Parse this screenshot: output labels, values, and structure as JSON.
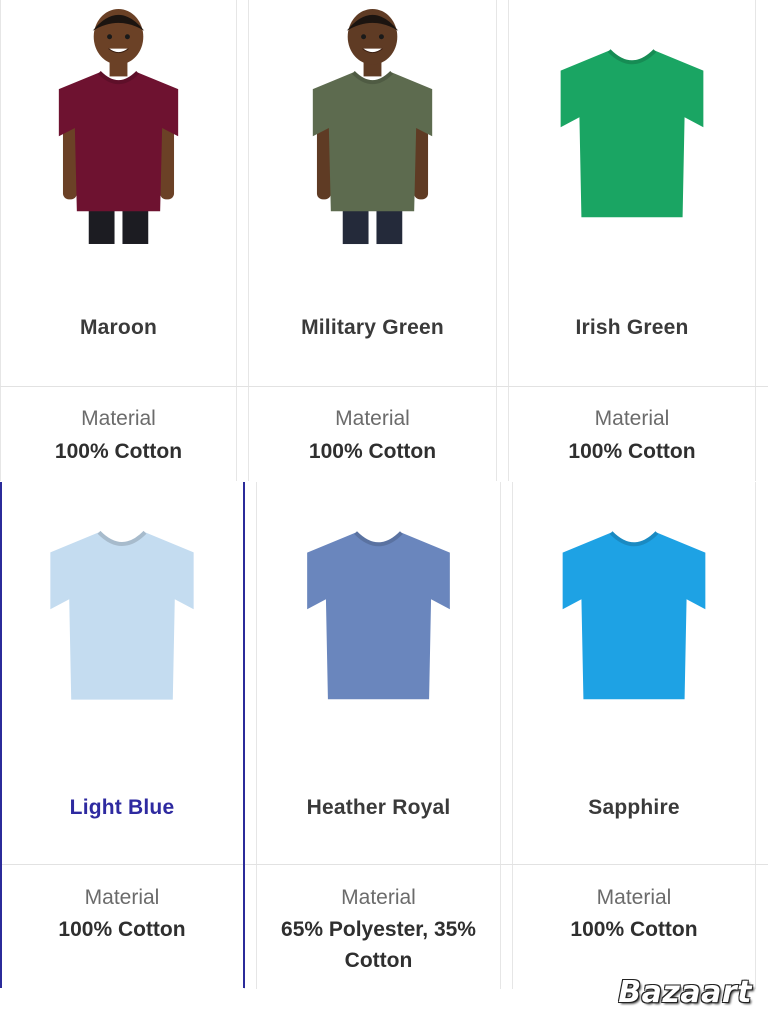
{
  "products": [
    {
      "color_name": "Maroon",
      "material_label": "Material",
      "material_value": "100% Cotton",
      "swatch": "#6e1230",
      "has_model": true,
      "skin": "#6b4126",
      "pants": "#1c1c22"
    },
    {
      "color_name": "Military Green",
      "material_label": "Material",
      "material_value": "100% Cotton",
      "swatch": "#5d6b4f",
      "has_model": true,
      "skin": "#5f3b24",
      "pants": "#242a3a"
    },
    {
      "color_name": "Irish Green",
      "material_label": "Material",
      "material_value": "100% Cotton",
      "swatch": "#1aa563",
      "has_model": false
    },
    {
      "color_name": "Light Blue",
      "material_label": "Material",
      "material_value": "100% Cotton",
      "swatch": "#c4dcf0",
      "has_model": false,
      "selected": true
    },
    {
      "color_name": "Heather Royal",
      "material_label": "Material",
      "material_value": "65% Polyester, 35% Cotton",
      "swatch": "#6a86bd",
      "has_model": false
    },
    {
      "color_name": "Sapphire",
      "material_label": "Material",
      "material_value": "100% Cotton",
      "swatch": "#1ea2e4",
      "has_model": false
    }
  ],
  "colors": {
    "selected_text": "#2e2aa0",
    "selected_border": "#2b2b9a",
    "name_text": "#3a3a3a",
    "label_text": "#6b6b6b"
  },
  "watermark": "Bazaart"
}
